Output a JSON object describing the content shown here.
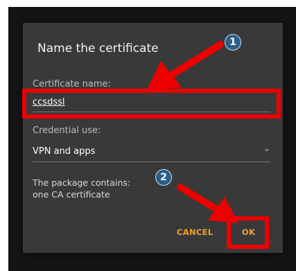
{
  "dialog": {
    "title": "Name the certificate",
    "certificate_name_label": "Certificate name:",
    "certificate_name_value": "ccsdssl",
    "credential_use_label": "Credential use:",
    "credential_use_value": "VPN and apps",
    "package_info_line1": "The package contains:",
    "package_info_line2": "one CA certificate",
    "cancel_label": "CANCEL",
    "ok_label": "OK"
  },
  "annotations": {
    "step1": "1",
    "step2": "2",
    "highlight_color": "#ee0000",
    "badge_color": "#2d5f86"
  }
}
